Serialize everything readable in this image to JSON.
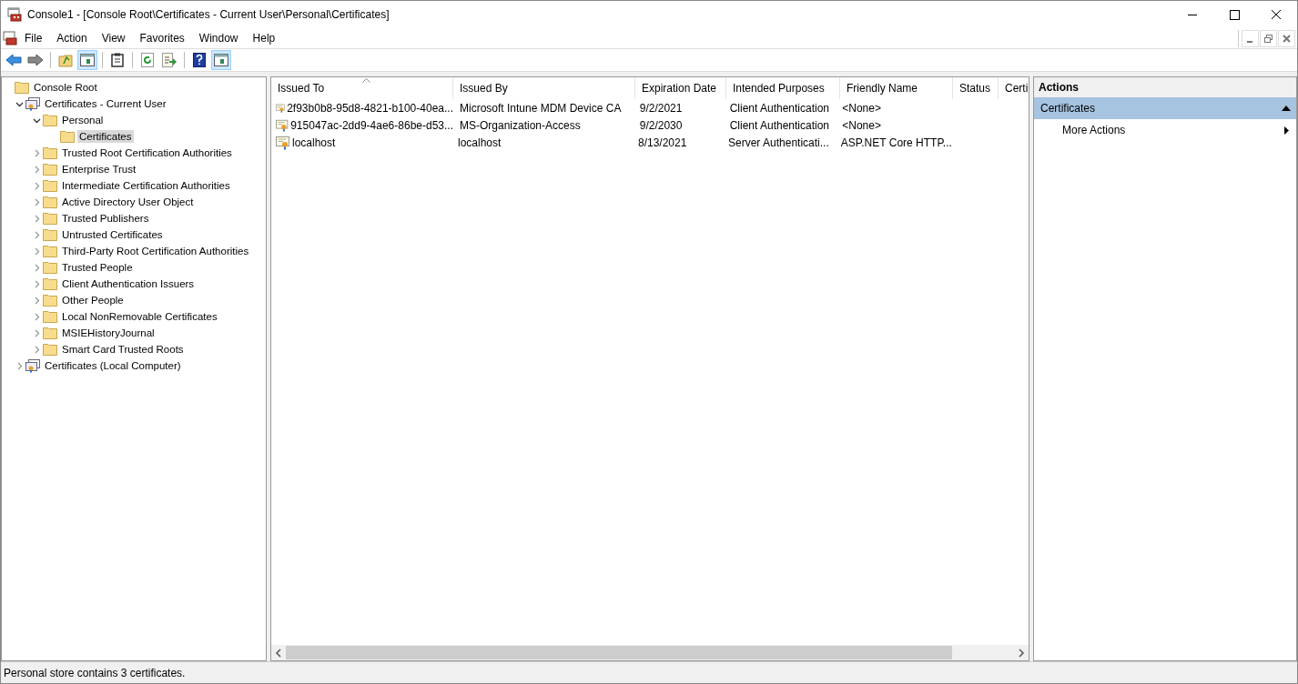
{
  "window": {
    "title": "Console1 - [Console Root\\Certificates - Current User\\Personal\\Certificates]"
  },
  "menu": [
    "File",
    "Action",
    "View",
    "Favorites",
    "Window",
    "Help"
  ],
  "toolbar": [
    [
      {
        "kind": "back",
        "pressed": false
      },
      {
        "kind": "forward",
        "pressed": false
      }
    ],
    [
      {
        "kind": "up",
        "pressed": false
      },
      {
        "kind": "console-tree",
        "pressed": true
      }
    ],
    [
      {
        "kind": "properties",
        "pressed": false
      }
    ],
    [
      {
        "kind": "refresh",
        "pressed": false
      },
      {
        "kind": "export",
        "pressed": false
      }
    ],
    [
      {
        "kind": "help",
        "pressed": false
      },
      {
        "kind": "action-pane",
        "pressed": true
      }
    ]
  ],
  "tree": [
    {
      "label": "Console Root",
      "kind": "folder",
      "selected": false,
      "children": [
        {
          "label": "Certificates - Current User",
          "kind": "store",
          "expanded": true,
          "selected": false,
          "children": [
            {
              "label": "Personal",
              "kind": "folder",
              "expanded": true,
              "selected": false,
              "children": [
                {
                  "label": "Certificates",
                  "kind": "folder",
                  "selected": true
                }
              ]
            },
            {
              "label": "Trusted Root Certification Authorities",
              "kind": "folder",
              "expanded": false,
              "selected": false
            },
            {
              "label": "Enterprise Trust",
              "kind": "folder",
              "expanded": false,
              "selected": false
            },
            {
              "label": "Intermediate Certification Authorities",
              "kind": "folder",
              "expanded": false,
              "selected": false
            },
            {
              "label": "Active Directory User Object",
              "kind": "folder",
              "expanded": false,
              "selected": false
            },
            {
              "label": "Trusted Publishers",
              "kind": "folder",
              "expanded": false,
              "selected": false
            },
            {
              "label": "Untrusted Certificates",
              "kind": "folder",
              "expanded": false,
              "selected": false
            },
            {
              "label": "Third-Party Root Certification Authorities",
              "kind": "folder",
              "expanded": false,
              "selected": false
            },
            {
              "label": "Trusted People",
              "kind": "folder",
              "expanded": false,
              "selected": false
            },
            {
              "label": "Client Authentication Issuers",
              "kind": "folder",
              "expanded": false,
              "selected": false
            },
            {
              "label": "Other People",
              "kind": "folder",
              "expanded": false,
              "selected": false
            },
            {
              "label": "Local NonRemovable Certificates",
              "kind": "folder",
              "expanded": false,
              "selected": false
            },
            {
              "label": "MSIEHistoryJournal",
              "kind": "folder",
              "expanded": false,
              "selected": false
            },
            {
              "label": "Smart Card Trusted Roots",
              "kind": "folder",
              "expanded": false,
              "selected": false
            }
          ]
        },
        {
          "label": "Certificates (Local Computer)",
          "kind": "store",
          "expanded": false,
          "selected": false
        }
      ]
    }
  ],
  "table": {
    "columns": [
      {
        "label": "Issued To",
        "sorted": true
      },
      {
        "label": "Issued By",
        "sorted": false
      },
      {
        "label": "Expiration Date",
        "sorted": false
      },
      {
        "label": "Intended Purposes",
        "sorted": false
      },
      {
        "label": "Friendly Name",
        "sorted": false
      },
      {
        "label": "Status",
        "sorted": false
      },
      {
        "label": "Certi",
        "sorted": false
      }
    ],
    "rows": [
      {
        "cells": [
          "2f93b0b8-95d8-4821-b100-40ea...",
          "Microsoft Intune MDM Device CA",
          "9/2/2021",
          "Client Authentication",
          "<None>",
          "",
          ""
        ]
      },
      {
        "cells": [
          "915047ac-2dd9-4ae6-86be-d53...",
          "MS-Organization-Access",
          "9/2/2030",
          "Client Authentication",
          "<None>",
          "",
          ""
        ]
      },
      {
        "cells": [
          "localhost",
          "localhost",
          "8/13/2021",
          "Server Authenticati...",
          "ASP.NET Core HTTP...",
          "",
          ""
        ]
      }
    ]
  },
  "actions": {
    "title": "Actions",
    "sections": [
      {
        "label": "Certificates",
        "expanded": true,
        "items": [
          "More Actions"
        ]
      }
    ]
  },
  "status_bar": "Personal store contains 3 certificates."
}
